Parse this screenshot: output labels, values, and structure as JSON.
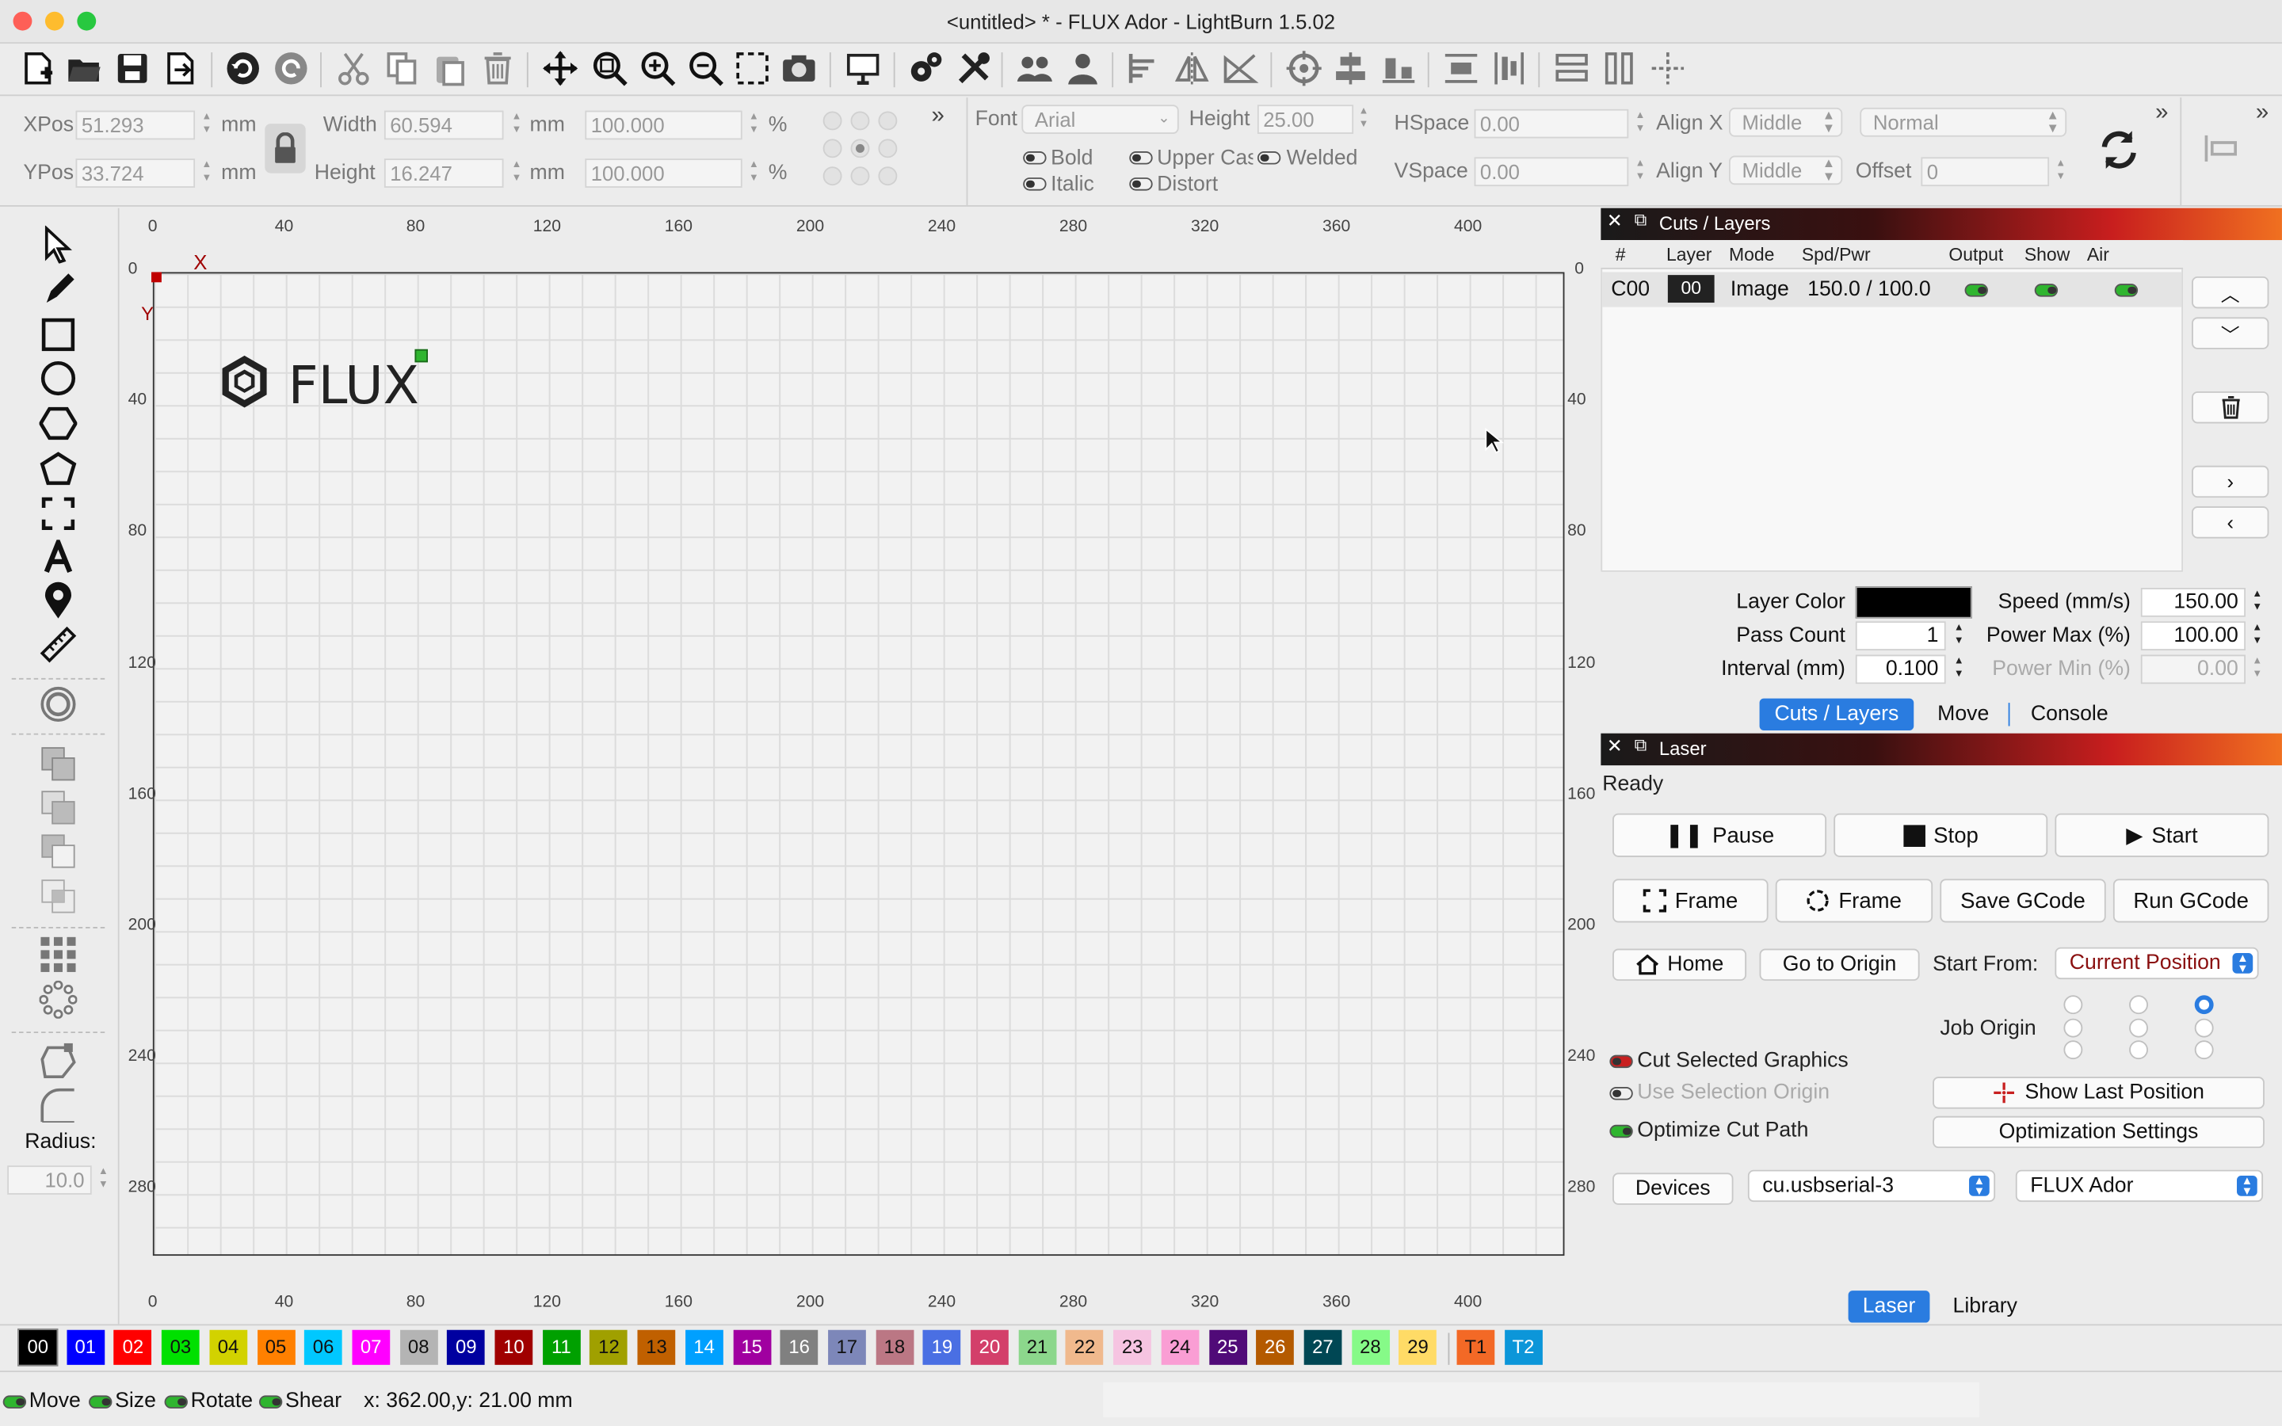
{
  "window": {
    "title": "<untitled> * - FLUX Ador - LightBurn 1.5.02"
  },
  "props": {
    "xpos_label": "XPos",
    "xpos": "51.293",
    "ypos_label": "YPos",
    "ypos": "33.724",
    "unit": "mm",
    "percent": "%",
    "width_label": "Width",
    "width": "60.594",
    "height_label": "Height",
    "height": "16.247",
    "scale_x": "100.000",
    "scale_y": "100.000",
    "font_label": "Font",
    "font": "Arial",
    "font_height_label": "Height",
    "font_height": "25.00",
    "hspace_label": "HSpace",
    "hspace": "0.00",
    "vspace_label": "VSpace",
    "vspace": "0.00",
    "alignx_label": "Align X",
    "alignx": "Middle",
    "aligny_label": "Align Y",
    "aligny": "Middle",
    "mode": "Normal",
    "offset_label": "Offset",
    "offset": "0",
    "bold": "Bold",
    "italic": "Italic",
    "upper": "Upper Case",
    "distort": "Distort",
    "welded": "Welded"
  },
  "ruler": {
    "x": [
      "0",
      "40",
      "80",
      "120",
      "160",
      "200",
      "240",
      "280",
      "320",
      "360",
      "400"
    ],
    "y": [
      "0",
      "40",
      "80",
      "120",
      "160",
      "200",
      "240",
      "280"
    ],
    "x_axis": "X",
    "y_axis": "Y"
  },
  "canvas": {
    "logo_text": "FLUX"
  },
  "left": {
    "radius_label": "Radius:",
    "radius": "10.0"
  },
  "cuts": {
    "title": "Cuts / Layers",
    "columns": [
      "#",
      "Layer",
      "Mode",
      "Spd/Pwr",
      "Output",
      "Show",
      "Air"
    ],
    "row": {
      "num": "C00",
      "layer": "00",
      "mode": "Image",
      "spdpwr": "150.0 / 100.0"
    },
    "layer_color_label": "Layer Color",
    "pass_count_label": "Pass Count",
    "pass_count": "1",
    "interval_label": "Interval (mm)",
    "interval": "0.100",
    "speed_label": "Speed (mm/s)",
    "speed": "150.00",
    "power_max_label": "Power Max (%)",
    "power_max": "100.00",
    "power_min_label": "Power Min (%)",
    "power_min": "0.00",
    "tabs": [
      "Cuts / Layers",
      "Move",
      "Console"
    ]
  },
  "laser": {
    "title": "Laser",
    "status": "Ready",
    "pause": "Pause",
    "stop": "Stop",
    "start": "Start",
    "frame1": "Frame",
    "frame2": "Frame",
    "save_gcode": "Save GCode",
    "run_gcode": "Run GCode",
    "home": "Home",
    "go_origin": "Go to Origin",
    "start_from_label": "Start From:",
    "start_from": "Current Position",
    "job_origin_label": "Job Origin",
    "cut_selected": "Cut Selected Graphics",
    "use_selection_origin": "Use Selection Origin",
    "optimize_cut_path": "Optimize Cut Path",
    "show_last_position": "Show Last Position",
    "optimization_settings": "Optimization Settings",
    "devices": "Devices",
    "port": "cu.usbserial-3",
    "device": "FLUX Ador",
    "tabs": [
      "Laser",
      "Library"
    ]
  },
  "palette": [
    {
      "label": "00",
      "color": "#000000",
      "fg": "#ffffff"
    },
    {
      "label": "01",
      "color": "#0000ff",
      "fg": "#ffffff"
    },
    {
      "label": "02",
      "color": "#ff0000",
      "fg": "#ffffff"
    },
    {
      "label": "03",
      "color": "#00e000",
      "fg": "#111111"
    },
    {
      "label": "04",
      "color": "#d2d200",
      "fg": "#111111"
    },
    {
      "label": "05",
      "color": "#ff8000",
      "fg": "#111111"
    },
    {
      "label": "06",
      "color": "#00c8ff",
      "fg": "#111111"
    },
    {
      "label": "07",
      "color": "#ff00ff",
      "fg": "#ffffff"
    },
    {
      "label": "08",
      "color": "#b4b4b4",
      "fg": "#111111"
    },
    {
      "label": "09",
      "color": "#0000a0",
      "fg": "#ffffff"
    },
    {
      "label": "10",
      "color": "#a00000",
      "fg": "#ffffff"
    },
    {
      "label": "11",
      "color": "#00a000",
      "fg": "#ffffff"
    },
    {
      "label": "12",
      "color": "#a0a000",
      "fg": "#111111"
    },
    {
      "label": "13",
      "color": "#c06000",
      "fg": "#111111"
    },
    {
      "label": "14",
      "color": "#00a0ff",
      "fg": "#ffffff"
    },
    {
      "label": "15",
      "color": "#a000a0",
      "fg": "#ffffff"
    },
    {
      "label": "16",
      "color": "#808080",
      "fg": "#ffffff"
    },
    {
      "label": "17",
      "color": "#7d87b9",
      "fg": "#111111"
    },
    {
      "label": "18",
      "color": "#bb7784",
      "fg": "#111111"
    },
    {
      "label": "19",
      "color": "#4a6fe3",
      "fg": "#ffffff"
    },
    {
      "label": "20",
      "color": "#d33f6a",
      "fg": "#ffffff"
    },
    {
      "label": "21",
      "color": "#8cd78c",
      "fg": "#111111"
    },
    {
      "label": "22",
      "color": "#f0b98d",
      "fg": "#111111"
    },
    {
      "label": "23",
      "color": "#f6c4e1",
      "fg": "#111111"
    },
    {
      "label": "24",
      "color": "#fa9ed4",
      "fg": "#111111"
    },
    {
      "label": "25",
      "color": "#500a78",
      "fg": "#ffffff"
    },
    {
      "label": "26",
      "color": "#b45a00",
      "fg": "#ffffff"
    },
    {
      "label": "27",
      "color": "#004754",
      "fg": "#ffffff"
    },
    {
      "label": "28",
      "color": "#86fa88",
      "fg": "#111111"
    },
    {
      "label": "29",
      "color": "#ffdb66",
      "fg": "#111111"
    },
    {
      "label": "T1",
      "color": "#f36926",
      "fg": "#111111"
    },
    {
      "label": "T2",
      "color": "#0c96d9",
      "fg": "#ffffff"
    }
  ],
  "status": {
    "move": "Move",
    "size": "Size",
    "rotate": "Rotate",
    "shear": "Shear",
    "coords": "x: 362.00,y: 21.00 mm"
  }
}
